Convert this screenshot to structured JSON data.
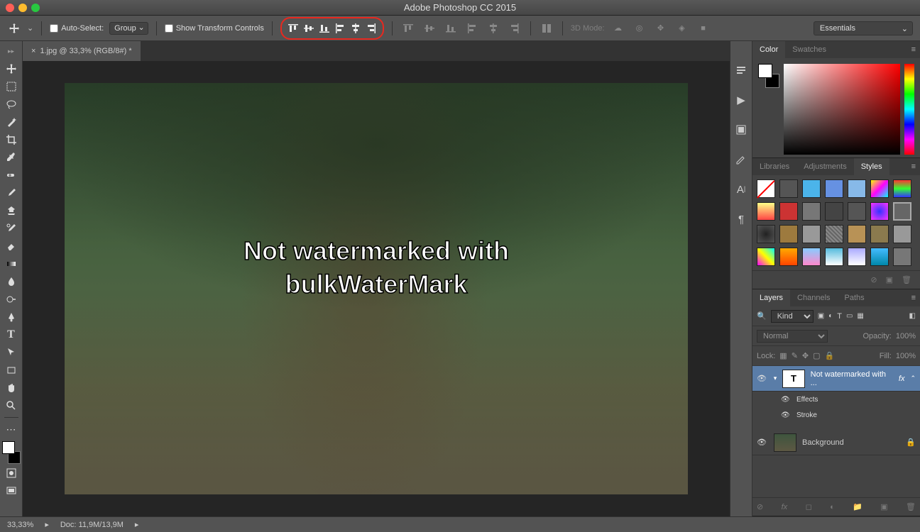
{
  "app": {
    "title": "Adobe Photoshop CC 2015"
  },
  "options": {
    "auto_select_label": "Auto-Select:",
    "auto_select_mode": "Group",
    "show_transform_label": "Show Transform Controls",
    "mode3d_label": "3D Mode:"
  },
  "workspace_selector": "Essentials",
  "document": {
    "tab_label": "1.jpg @ 33,3% (RGB/8#) *",
    "canvas_text_line1": "Not watermarked with",
    "canvas_text_line2": "bulkWaterMark"
  },
  "panels": {
    "color_tabs": [
      "Color",
      "Swatches"
    ],
    "lib_tabs": [
      "Libraries",
      "Adjustments",
      "Styles"
    ],
    "layer_tabs": [
      "Layers",
      "Channels",
      "Paths"
    ],
    "layers": {
      "filter_kind": "Kind",
      "blend_mode": "Normal",
      "opacity_label": "Opacity:",
      "opacity_value": "100%",
      "lock_label": "Lock:",
      "fill_label": "Fill:",
      "fill_value": "100%",
      "items": [
        {
          "name": "Not watermarked with ...",
          "type": "T",
          "fx": "fx"
        },
        {
          "name": "Background",
          "type": "img",
          "locked": true
        }
      ],
      "effects_label": "Effects",
      "stroke_label": "Stroke"
    }
  },
  "status": {
    "zoom": "33,33%",
    "doc_size": "Doc: 11,9M/13,9M"
  }
}
